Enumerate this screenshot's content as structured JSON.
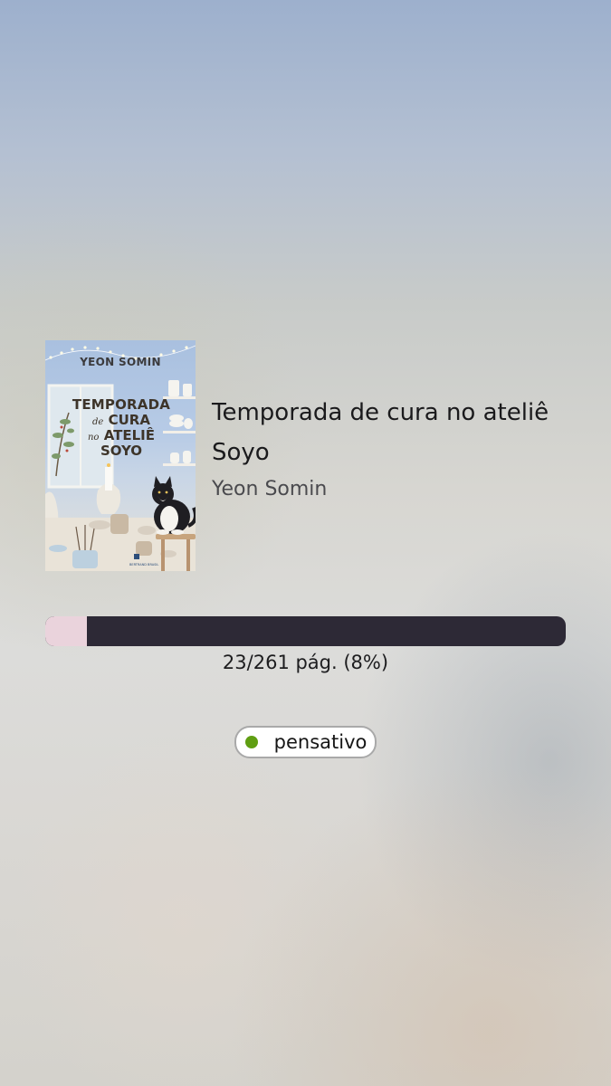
{
  "book": {
    "title": "Temporada de cura no ateliê Soyo",
    "author": "Yeon Somin",
    "cover": {
      "author_text": "YEON SOMIN",
      "title_line1": "TEMPORADA",
      "title_de": "de",
      "title_line2": "CURA",
      "title_no": "no",
      "title_line3": "ATELIÊ",
      "title_line4": "SOYO"
    }
  },
  "progress": {
    "current_page": 23,
    "total_pages": 261,
    "percent": 8,
    "label": "23/261 pág. (8%)",
    "track_color": "#2d2936",
    "fill_color": "#ead3dc"
  },
  "mood": {
    "label": "pensativo",
    "dot_color": "#5f9e12"
  }
}
